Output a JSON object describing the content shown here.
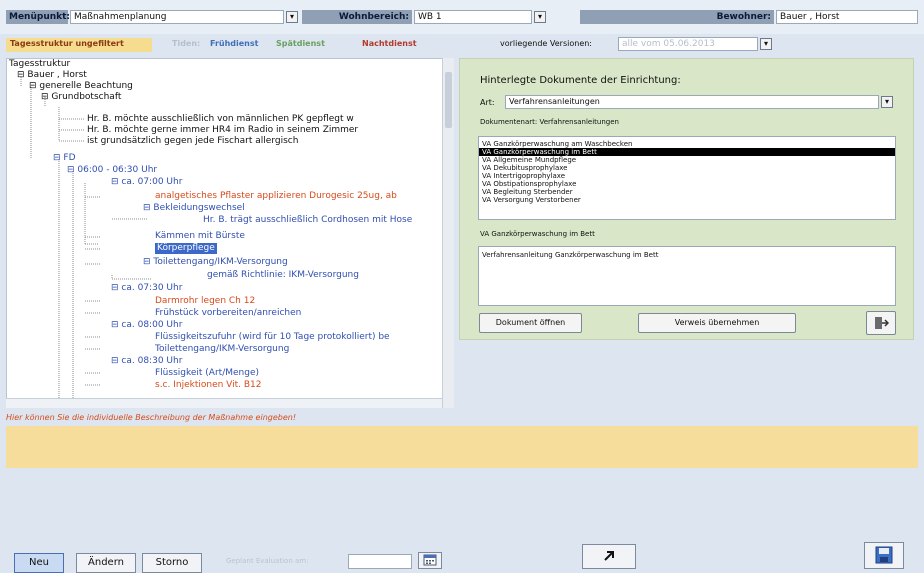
{
  "top": {
    "menu_label": "Menüpunkt:",
    "menu_value": "Maßnahmenplanung",
    "area_label": "Wohnbereich:",
    "area_value": "WB 1",
    "resident_label": "Bewohner:",
    "resident_value": "Bauer , Horst"
  },
  "filter": {
    "tagesstruktur": "Tagesstruktur ungefiltert",
    "items": [
      "Tiden:",
      "Frühdienst",
      "Spätdienst",
      "Nachtdienst"
    ],
    "versions_label": "vorliegende Versionen:",
    "versions_value": "alle vom 05.06.2013"
  },
  "tree": [
    {
      "text": "Tagesstruktur",
      "color": "blk"
    },
    {
      "text": "Bauer , Horst",
      "color": "blk"
    },
    {
      "text": "generelle Beachtung",
      "color": "blk"
    },
    {
      "text": "Grundbotschaft",
      "color": "blk"
    },
    {
      "text": "Hr. B. möchte ausschließlich von männlichen PK gepflegt w",
      "color": "blk"
    },
    {
      "text": "Hr. B. möchte gerne immer HR4 im Radio in seinem Zimmer",
      "color": "blk"
    },
    {
      "text": "ist grundsätzlich gegen jede Fischart allergisch",
      "color": "blk"
    },
    {
      "text": "FD",
      "color": "blu"
    },
    {
      "text": "06:00 - 06:30 Uhr",
      "color": "blu"
    },
    {
      "text": "ca. 07:00 Uhr",
      "color": "blu"
    },
    {
      "text": "analgetisches Pflaster applizieren Durogesic 25ug, ab",
      "color": "red"
    },
    {
      "text": "Bekleidungswechsel",
      "color": "blu"
    },
    {
      "text": "Hr. B. trägt ausschließlich Cordhosen mit Hose",
      "color": "blu"
    },
    {
      "text": "Kämmen mit Bürste",
      "color": "blu"
    },
    {
      "text": "Körperpflege",
      "color": "blu"
    },
    {
      "text": "Toilettengang/IKM-Versorgung",
      "color": "blu"
    },
    {
      "text": "gemäß Richtlinie: IKM-Versorgung",
      "color": "blu"
    },
    {
      "text": "ca. 07:30 Uhr",
      "color": "blu"
    },
    {
      "text": "Darmrohr legen Ch 12",
      "color": "red"
    },
    {
      "text": "Frühstück vorbereiten/anreichen",
      "color": "blu"
    },
    {
      "text": "ca. 08:00 Uhr",
      "color": "blu"
    },
    {
      "text": "Flüssigkeitszufuhr (wird für 10 Tage protokolliert) be",
      "color": "blu"
    },
    {
      "text": "Toilettengang/IKM-Versorgung",
      "color": "blu"
    },
    {
      "text": "ca. 08:30 Uhr",
      "color": "blu"
    },
    {
      "text": "Flüssigkeit (Art/Menge)",
      "color": "blu"
    },
    {
      "text": "s.c. Injektionen Vit. B12",
      "color": "red"
    }
  ],
  "panel": {
    "title": "Hinterlegte Dokumente der Einrichtung:",
    "art_label": "Art:",
    "art_value": "Verfahrensanleitungen",
    "docs_label": "Dokumentenart: Verfahrensanleitungen",
    "docs": [
      "VA Ganzkörperwaschung am Waschbecken",
      "VA Ganzkörperwaschung im Bett",
      "VA Allgemeine Mundpflege",
      "VA Dekubitusprophylaxe",
      "VA Intertrigoprophylaxe",
      "VA Obstipationsprophylaxe",
      "VA Begleitung Sterbender",
      "VA Versorgung Verstorbener"
    ],
    "selected_index": 1,
    "selected_title": "VA Ganzkörperwaschung im Bett",
    "detail_text": "Verfahrensanleitung Ganzkörperwaschung im Bett",
    "btn_open": "Dokument öffnen",
    "btn_apply": "Verweis übernehmen",
    "exit_icon": "door-exit-icon"
  },
  "description": {
    "label": "Hier können Sie die individuelle Beschreibung der Maßnahme eingeben!"
  },
  "bottom": {
    "btn_new": "Neu",
    "btn_change": "Ändern",
    "btn_cancel": "Storno",
    "eval_label": "Geplant Evaluation am:",
    "eval_value": "",
    "calendar_icon": "calendar-icon",
    "arrow_icon": "arrow-up-right-icon",
    "save_icon": "save-disk-icon"
  },
  "colors": {
    "accent": "#2f4fb0",
    "warn": "#d84a1b",
    "panel": "#d9e6c7",
    "desc": "#f6dd9c"
  }
}
